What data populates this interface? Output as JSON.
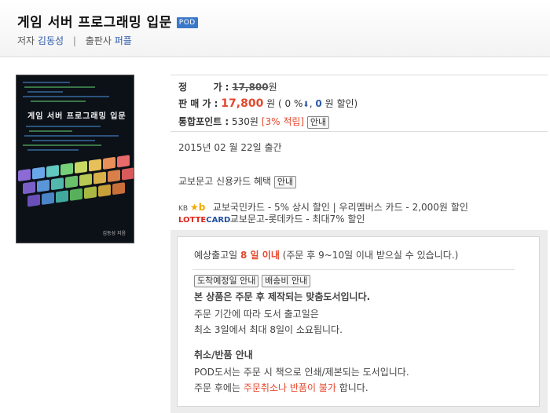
{
  "header": {
    "title": "게임 서버 프로그래밍 입문",
    "badge": "POD",
    "author_label": "저자",
    "author": "김동성",
    "publisher_label": "출판사",
    "publisher": "퍼플",
    "separator": "|"
  },
  "cover": {
    "title": "게임 서버 프로그래밍 입문",
    "author_tag": "김동성 지음"
  },
  "price": {
    "list_label": "정        가 :",
    "list_price": "17,800",
    "unit": "원",
    "sale_label": "판 매 가 :",
    "sale_price": "17,800",
    "discount_open": "( 0 %",
    "discount_arrow": "⬇",
    "discount_sep": ",",
    "discount_amount": "0",
    "discount_close": "원 할인)",
    "points_label": "통합포인트 :",
    "points": "530원",
    "points_rate": "[3% 적립]",
    "info_button": "안내"
  },
  "release_date": "2015년 02 월 22일 출간",
  "card_benefit": {
    "label": "교보문고 신용카드 혜택",
    "button": "안내"
  },
  "cards": [
    {
      "logo_small": "KB",
      "logo_mark": "★b",
      "text": "교보국민카드 - 5% 상시 할인  |  우리멤버스 카드 - 2,000원 할인"
    },
    {
      "logo_a": "LOTTE",
      "logo_b": "CARD",
      "text": "교보문고-롯데카드 - 최대7% 할인"
    }
  ],
  "shipping": {
    "expected_prefix": "예상출고일",
    "expected_days": "8 일 이내",
    "expected_suffix": "(주문 후 9~10일 이내 받으실 수 있습니다.)",
    "btn_arrival": "도착예정일 안내",
    "btn_fee": "배송비 안내",
    "notice_head": "본 상품은 주문 후 제작되는 맞춤도서입니다.",
    "notice_line1": "주문 기간에 따라 도서 출고일은",
    "notice_line2": "최소 3일에서 최대 8일이 소요됩니다.",
    "cancel_head": "취소/반품 안내",
    "cancel_line1": "POD도서는 주문 시 책으로 인쇄/제본되는 도서입니다.",
    "cancel_line2_prefix": "주문 후에는",
    "cancel_line2_red": "주문취소나 반품이 불가",
    "cancel_line2_suffix": "합니다."
  },
  "colors": {
    "accent_red": "#e5472d",
    "link_blue": "#2b5aa6",
    "notice_green": "#2e7d1e",
    "cancel_teal": "#1f8a8a",
    "badge_blue": "#3a78c8"
  }
}
